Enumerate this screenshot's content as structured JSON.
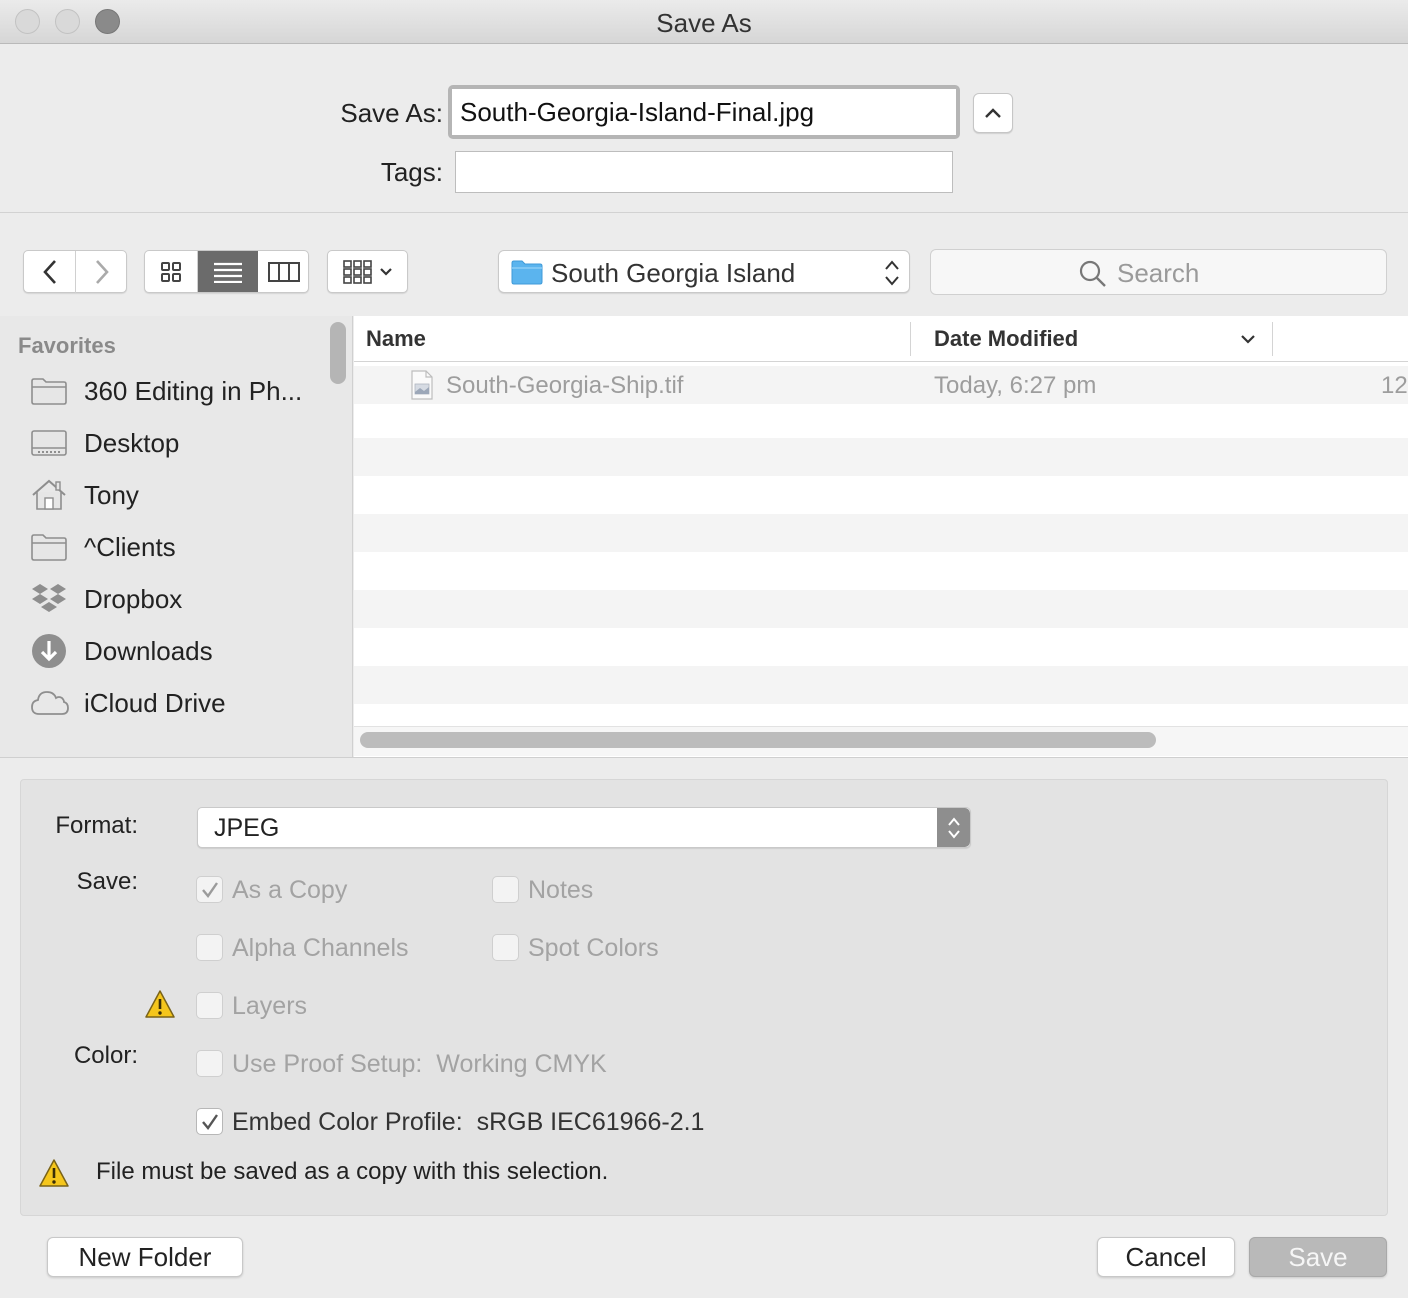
{
  "window": {
    "title": "Save As"
  },
  "name_area": {
    "save_as_label": "Save As:",
    "filename_value": "South-Georgia-Island-Final.jpg",
    "tags_label": "Tags:",
    "tags_value": ""
  },
  "toolbar": {
    "location_label": "South Georgia Island",
    "search_placeholder": "Search"
  },
  "sidebar": {
    "section_title": "Favorites",
    "items": [
      {
        "label": "360 Editing in Ph...",
        "icon": "folder-icon"
      },
      {
        "label": "Desktop",
        "icon": "desktop-icon"
      },
      {
        "label": "Tony",
        "icon": "home-icon"
      },
      {
        "label": "^Clients",
        "icon": "folder-icon"
      },
      {
        "label": "Dropbox",
        "icon": "dropbox-icon"
      },
      {
        "label": "Downloads",
        "icon": "downloads-icon"
      },
      {
        "label": "iCloud Drive",
        "icon": "icloud-icon"
      }
    ]
  },
  "file_list": {
    "columns": [
      "Name",
      "Date Modified"
    ],
    "rows": [
      {
        "name": "South-Georgia-Ship.tif",
        "date": "Today, 6:27 pm",
        "size": "12"
      }
    ]
  },
  "options": {
    "format_label": "Format:",
    "format_value": "JPEG",
    "save_label": "Save:",
    "as_a_copy": "As a Copy",
    "notes": "Notes",
    "alpha_channels": "Alpha Channels",
    "spot_colors": "Spot Colors",
    "layers": "Layers",
    "color_label": "Color:",
    "use_proof_setup": "Use Proof Setup:",
    "proof_setup_value": "Working CMYK",
    "embed_color_profile": "Embed Color Profile:",
    "embed_profile_value": "sRGB IEC61966-2.1",
    "warning_text": "File must be saved as a copy with this selection."
  },
  "buttons": {
    "new_folder": "New Folder",
    "cancel": "Cancel",
    "save": "Save"
  },
  "colors": {
    "warning_yellow": "#f5c61c",
    "folder_blue": "#5bb4ee"
  }
}
